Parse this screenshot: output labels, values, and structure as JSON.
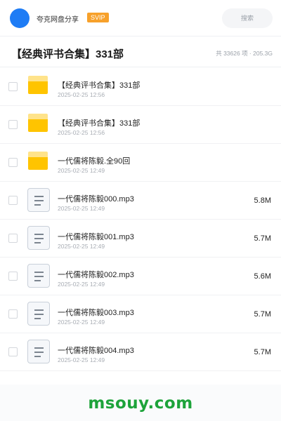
{
  "header": {
    "user_name": "夸克网盘分享",
    "badge": "SVIP",
    "search_placeholder": "搜索",
    "avatar_color": "#1e7cf5"
  },
  "share": {
    "title": "【经典评书合集】331部",
    "stats": "共 33626 项 · 205.3G"
  },
  "files": [
    {
      "type": "folder",
      "icon": "folder-icon",
      "name": "【经典评书合集】331部",
      "date": "2025-02-25 12:56",
      "size": ""
    },
    {
      "type": "folder",
      "icon": "folder-icon",
      "name": "【经典评书合集】331部",
      "date": "2025-02-25 12:56",
      "size": ""
    },
    {
      "type": "folder",
      "icon": "folder-icon",
      "name": "一代儒将陈毅.全90回",
      "date": "2025-02-25 12:49",
      "size": ""
    },
    {
      "type": "audio",
      "icon": "audio-file-icon",
      "name": "一代儒将陈毅000.mp3",
      "date": "2025-02-25 12:49",
      "size": "5.8M"
    },
    {
      "type": "audio",
      "icon": "audio-file-icon",
      "name": "一代儒将陈毅001.mp3",
      "date": "2025-02-25 12:49",
      "size": "5.7M"
    },
    {
      "type": "audio",
      "icon": "audio-file-icon",
      "name": "一代儒将陈毅002.mp3",
      "date": "2025-02-25 12:49",
      "size": "5.6M"
    },
    {
      "type": "audio",
      "icon": "audio-file-icon",
      "name": "一代儒将陈毅003.mp3",
      "date": "2025-02-25 12:49",
      "size": "5.7M"
    },
    {
      "type": "audio",
      "icon": "audio-file-icon",
      "name": "一代儒将陈毅004.mp3",
      "date": "2025-02-25 12:49",
      "size": "5.7M"
    }
  ],
  "footer": {
    "watermark": "msouy.com",
    "watermark_color": "#1da33a"
  }
}
